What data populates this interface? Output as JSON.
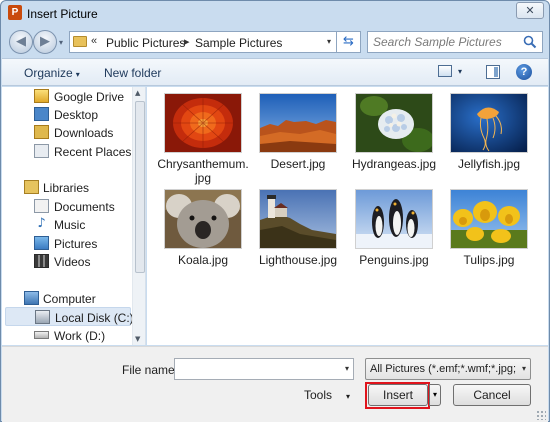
{
  "window": {
    "title": "Insert Picture",
    "app_icon": "P",
    "close_glyph": "✕"
  },
  "navigation": {
    "back_glyph": "◀",
    "forward_glyph": "▶",
    "history_glyph": "▾",
    "breadcrumb_separator": "«",
    "breadcrumb": [
      "Public Pictures",
      "Sample Pictures"
    ],
    "crumb_arrow": "▸",
    "dropdown_glyph": "▾",
    "refresh_glyph": "⇆",
    "search_placeholder": "Search Sample Pictures"
  },
  "toolbar": {
    "organize_label": "Organize",
    "new_folder_label": "New folder",
    "caret": "▾",
    "help_glyph": "?"
  },
  "sidebar": {
    "favorites": [
      {
        "label": "Google Drive",
        "icon": "google-drive-icon"
      },
      {
        "label": "Desktop",
        "icon": "desktop-icon"
      },
      {
        "label": "Downloads",
        "icon": "downloads-icon"
      },
      {
        "label": "Recent Places",
        "icon": "recent-places-icon"
      }
    ],
    "libraries": {
      "label": "Libraries",
      "items": [
        {
          "label": "Documents",
          "icon": "documents-icon"
        },
        {
          "label": "Music",
          "icon": "music-icon"
        },
        {
          "label": "Pictures",
          "icon": "pictures-icon"
        },
        {
          "label": "Videos",
          "icon": "videos-icon"
        }
      ]
    },
    "computer": {
      "label": "Computer",
      "items": [
        {
          "label": "Local Disk (C:)",
          "icon": "local-disk-icon",
          "selected": true
        },
        {
          "label": "Work (D:)",
          "icon": "drive-icon",
          "selected": false
        }
      ]
    },
    "music_glyph": "♪",
    "scroll_up": "▲",
    "scroll_down": "▼"
  },
  "files": [
    {
      "name": "Chrysanthemum.jpg",
      "line1": "Chrysanthemum.",
      "line2": "jpg"
    },
    {
      "name": "Desert.jpg",
      "line1": "Desert.jpg",
      "line2": ""
    },
    {
      "name": "Hydrangeas.jpg",
      "line1": "Hydrangeas.jpg",
      "line2": ""
    },
    {
      "name": "Jellyfish.jpg",
      "line1": "Jellyfish.jpg",
      "line2": ""
    },
    {
      "name": "Koala.jpg",
      "line1": "Koala.jpg",
      "line2": ""
    },
    {
      "name": "Lighthouse.jpg",
      "line1": "Lighthouse.jpg",
      "line2": ""
    },
    {
      "name": "Penguins.jpg",
      "line1": "Penguins.jpg",
      "line2": ""
    },
    {
      "name": "Tulips.jpg",
      "line1": "Tulips.jpg",
      "line2": ""
    }
  ],
  "footer": {
    "file_name_label": "File name:",
    "file_name_value": "",
    "filter_value": "All Pictures (*.emf;*.wmf;*.jpg;*",
    "tools_label": "Tools",
    "insert_label": "Insert",
    "cancel_label": "Cancel",
    "caret": "▾",
    "highlight_color": "#e0141c"
  }
}
